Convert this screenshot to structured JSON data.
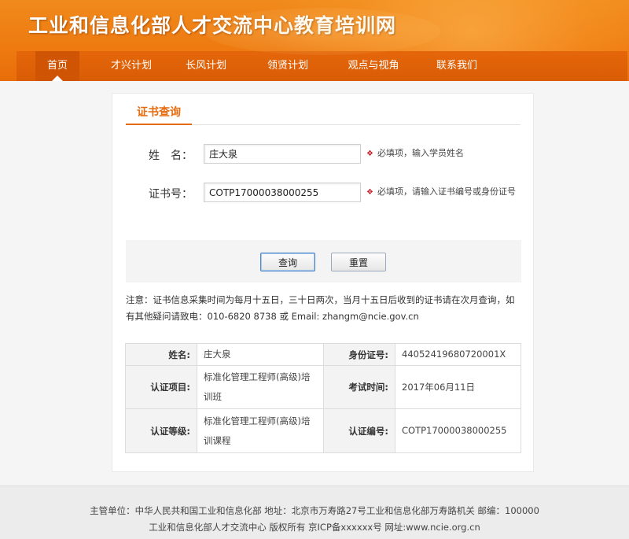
{
  "header": {
    "site_title": "工业和信息化部人才交流中心教育培训网"
  },
  "nav": {
    "items": [
      {
        "label": "首页"
      },
      {
        "label": "才兴计划"
      },
      {
        "label": "长风计划"
      },
      {
        "label": "领贤计划"
      },
      {
        "label": "观点与视角"
      },
      {
        "label": "联系我们"
      }
    ]
  },
  "panel": {
    "title": "证书查询",
    "form": {
      "name_label": "姓　名：",
      "name_value": "庄大泉",
      "name_hint": "必填项，输入学员姓名",
      "cert_label": "证书号：",
      "cert_value": "COTP17000038000255",
      "cert_hint": "必填项，请输入证书编号或身份证号",
      "hint_icon": "❖"
    },
    "buttons": {
      "query": "查询",
      "reset": "重置"
    },
    "notice": "注意：证书信息采集时间为每月十五日，三十日两次，当月十五日后收到的证书请在次月查询，如有其他疑问请致电：010-6820 8738 或 Email: zhangm@ncie.gov.cn",
    "result": {
      "rows": [
        {
          "k1": "姓名:",
          "v1": "庄大泉",
          "k2": "身份证号:",
          "v2": "44052419680720001X"
        },
        {
          "k1": "认证项目:",
          "v1": "标准化管理工程师(高级)培训班",
          "k2": "考试时间:",
          "v2": "2017年06月11日"
        },
        {
          "k1": "认证等级:",
          "v1": "标准化管理工程师(高级)培训课程",
          "k2": "认证编号:",
          "v2": "COTP17000038000255"
        }
      ]
    }
  },
  "footer": {
    "line1": "主管单位：中华人民共和国工业和信息化部 地址：北京市万寿路27号工业和信息化部万寿路机关 邮编：100000",
    "line2": "工业和信息化部人才交流中心 版权所有 京ICP备xxxxxx号 网址:www.ncie.org.cn"
  },
  "colors": {
    "brand_orange": "#ee7a10",
    "accent": "#e66b0d",
    "required_mark": "#c9202a"
  }
}
